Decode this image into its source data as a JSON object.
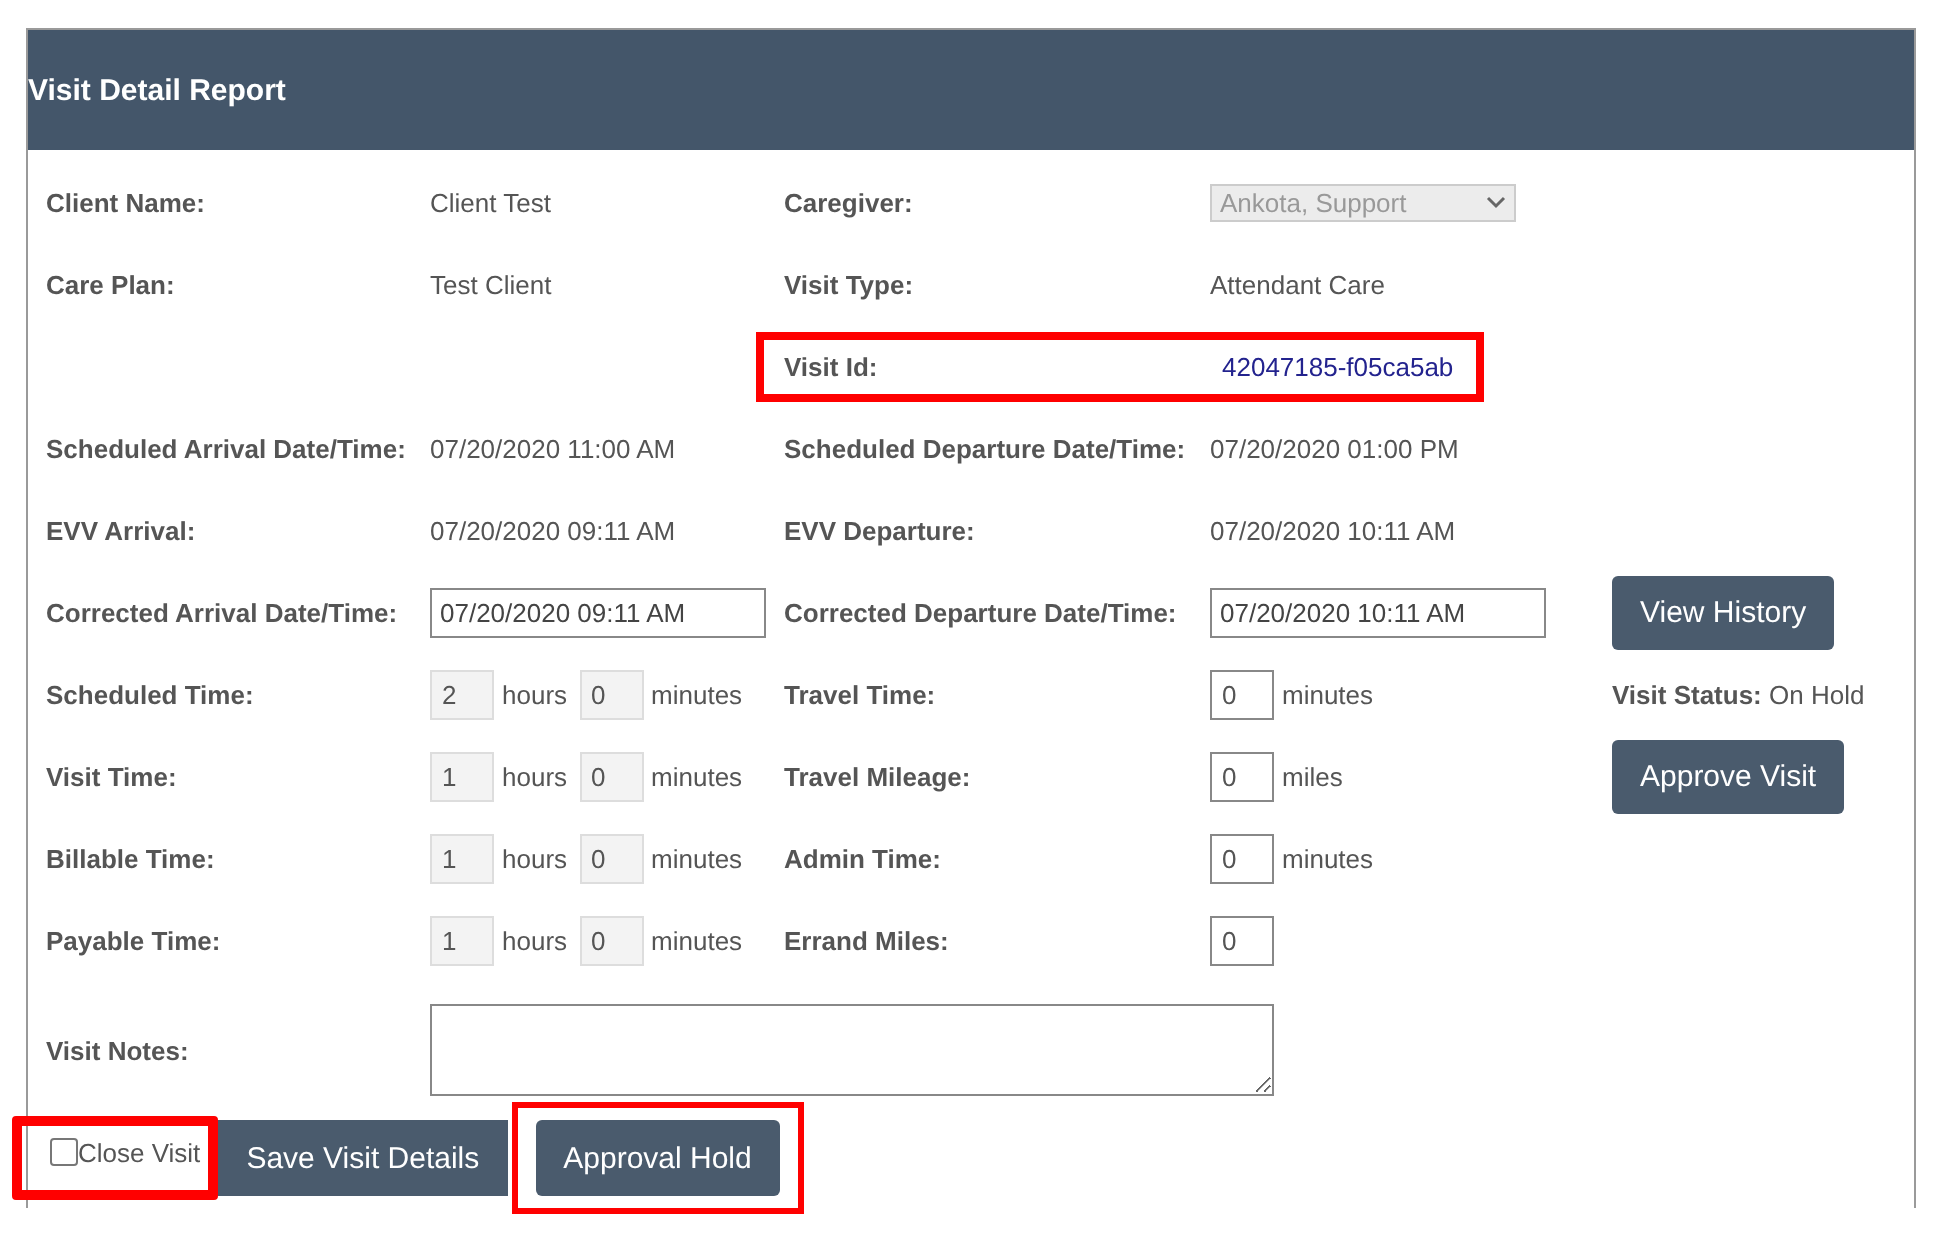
{
  "header": {
    "title": "Visit Detail Report"
  },
  "rows": [
    {
      "left": {
        "label": "Client Name:",
        "value": {
          "kind": "text",
          "text": "Client Test"
        }
      },
      "right": {
        "label": "Caregiver:",
        "highlighted": false,
        "value": {
          "kind": "select",
          "text": "Ankota, Support",
          "disabled": true
        }
      }
    },
    {
      "left": {
        "label": "Care Plan:",
        "value": {
          "kind": "text",
          "text": "Test Client"
        }
      },
      "right": {
        "label": "Visit Type:",
        "highlighted": false,
        "value": {
          "kind": "text",
          "text": "Attendant Care"
        }
      }
    },
    {
      "right": {
        "label": "Visit Id:",
        "highlighted": true,
        "value": {
          "kind": "link",
          "text": "42047185-f05ca5ab"
        }
      }
    },
    {
      "left": {
        "label": "Scheduled Arrival Date/Time:",
        "value": {
          "kind": "text",
          "text": "07/20/2020 11:00 AM"
        }
      },
      "right": {
        "label": "Scheduled Departure Date/Time:",
        "highlighted": false,
        "value": {
          "kind": "text",
          "text": "07/20/2020 01:00 PM"
        }
      }
    },
    {
      "left": {
        "label": "EVV Arrival:",
        "value": {
          "kind": "text",
          "text": "07/20/2020 09:11 AM"
        }
      },
      "right": {
        "label": "EVV Departure:",
        "highlighted": false,
        "value": {
          "kind": "text",
          "text": "07/20/2020 10:11 AM"
        }
      }
    },
    {
      "left": {
        "label": "Corrected Arrival Date/Time:",
        "value": {
          "kind": "input",
          "text": "07/20/2020 09:11 AM"
        }
      },
      "right": {
        "label": "Corrected Departure Date/Time:",
        "highlighted": false,
        "value": {
          "kind": "input",
          "text": "07/20/2020 10:11 AM"
        }
      },
      "side": {
        "kind": "button",
        "label": "View History"
      }
    },
    {
      "left": {
        "label": "Scheduled Time:",
        "value": {
          "kind": "number",
          "parts": [
            {
              "text": "2",
              "unit": "hours",
              "disabled": true
            },
            {
              "text": "0",
              "unit": "minutes",
              "disabled": true
            }
          ]
        }
      },
      "right": {
        "label": "Travel Time:",
        "highlighted": false,
        "value": {
          "kind": "number",
          "parts": [
            {
              "text": "0",
              "unit": "minutes",
              "disabled": false
            }
          ]
        }
      },
      "side": {
        "kind": "status",
        "label": "Visit Status:",
        "text": "On Hold"
      }
    },
    {
      "left": {
        "label": "Visit Time:",
        "value": {
          "kind": "number",
          "parts": [
            {
              "text": "1",
              "unit": "hours",
              "disabled": true
            },
            {
              "text": "0",
              "unit": "minutes",
              "disabled": true
            }
          ]
        }
      },
      "right": {
        "label": "Travel Mileage:",
        "highlighted": false,
        "value": {
          "kind": "number",
          "parts": [
            {
              "text": "0",
              "unit": "miles",
              "disabled": false
            }
          ]
        }
      },
      "side": {
        "kind": "button",
        "label": "Approve Visit"
      }
    },
    {
      "left": {
        "label": "Billable Time:",
        "value": {
          "kind": "number",
          "parts": [
            {
              "text": "1",
              "unit": "hours",
              "disabled": true
            },
            {
              "text": "0",
              "unit": "minutes",
              "disabled": true
            }
          ]
        }
      },
      "right": {
        "label": "Admin Time:",
        "highlighted": false,
        "value": {
          "kind": "number",
          "parts": [
            {
              "text": "0",
              "unit": "minutes",
              "disabled": false
            }
          ]
        }
      }
    },
    {
      "left": {
        "label": "Payable Time:",
        "value": {
          "kind": "number",
          "parts": [
            {
              "text": "1",
              "unit": "hours",
              "disabled": true
            },
            {
              "text": "0",
              "unit": "minutes",
              "disabled": true
            }
          ]
        }
      },
      "right": {
        "label": "Errand Miles:",
        "highlighted": false,
        "value": {
          "kind": "number",
          "parts": [
            {
              "text": "0",
              "disabled": false
            }
          ]
        }
      }
    }
  ],
  "notes": {
    "label": "Visit Notes:"
  },
  "close_visit": {
    "label": "Close Visit",
    "checked": false,
    "highlighted": true
  },
  "buttons": [
    {
      "label": "Save Visit Details",
      "highlighted": false
    },
    {
      "label": "Approval Hold",
      "highlighted": true
    }
  ]
}
